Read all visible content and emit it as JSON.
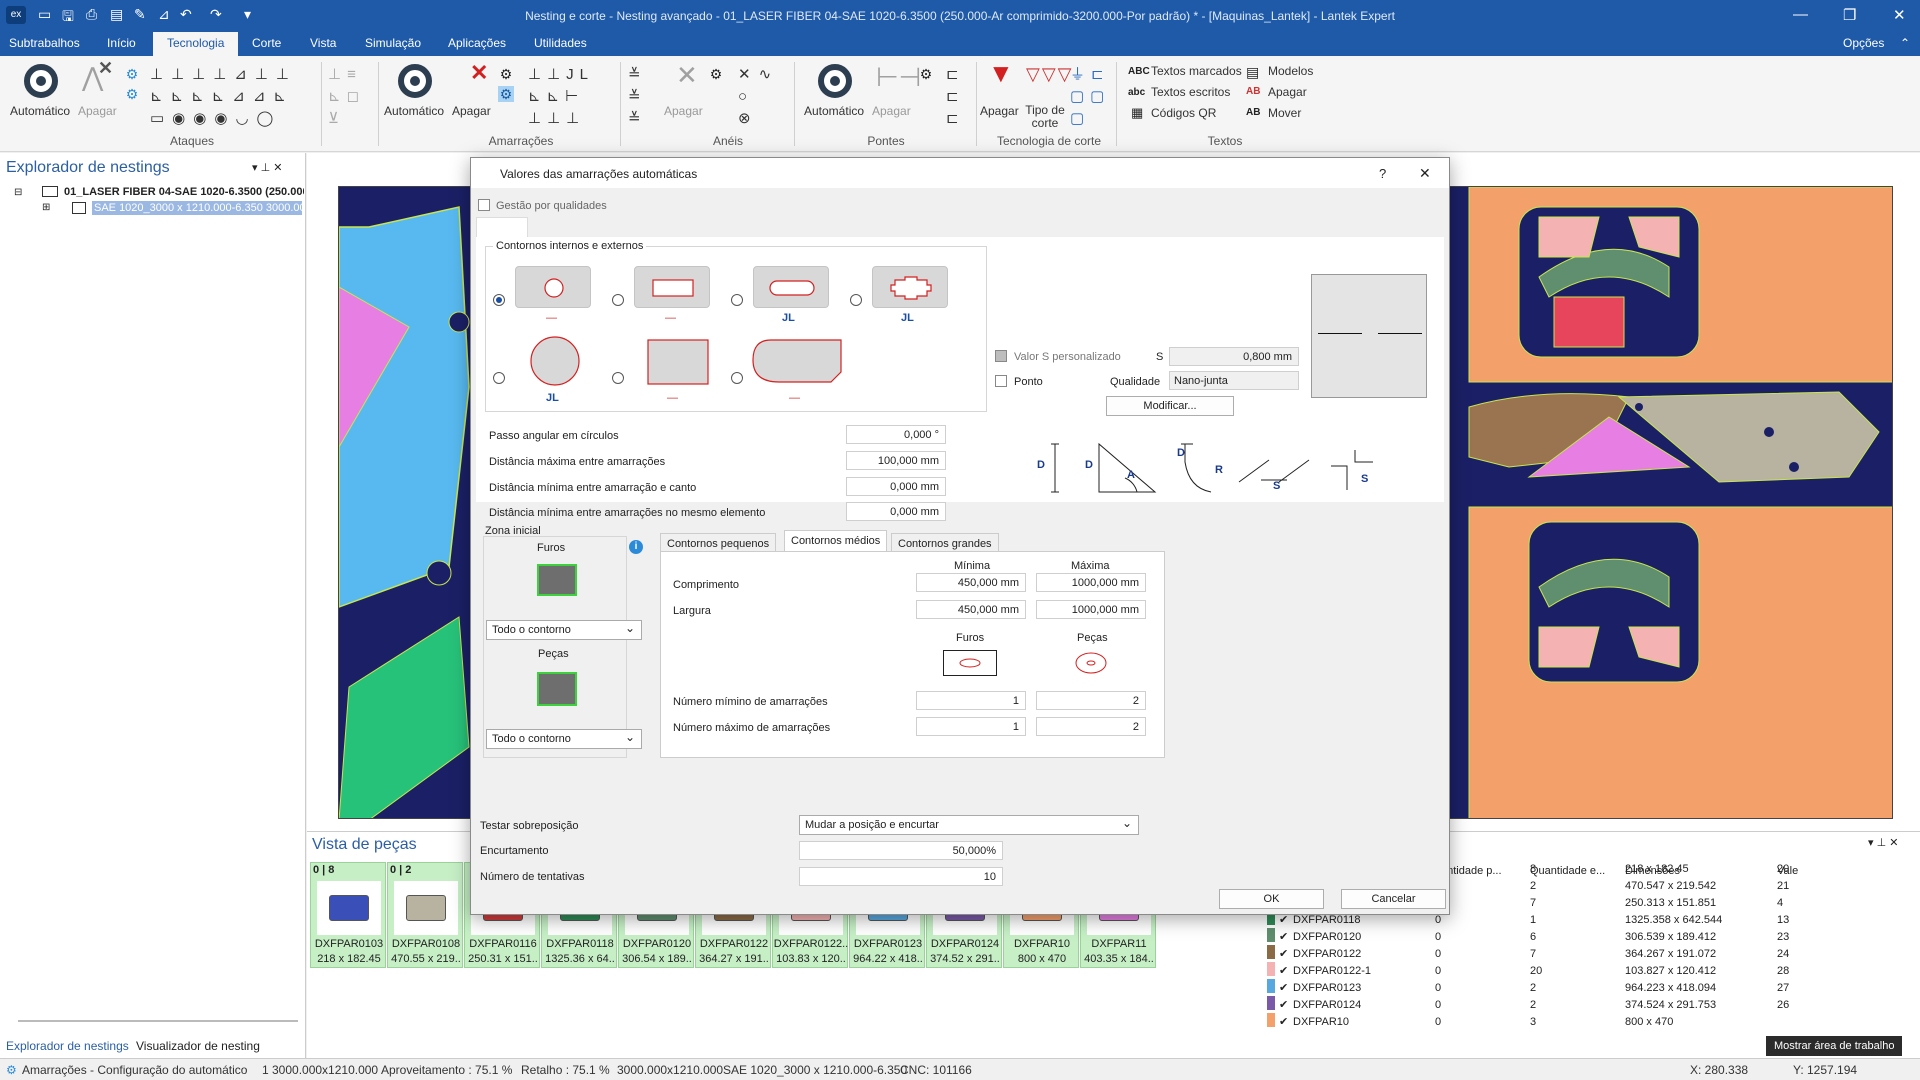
{
  "window": {
    "title": "Nesting e corte - Nesting avançado - 01_LASER FIBER 04-SAE 1020-6.3500 (250.000-Ar comprimido-3200.000-Por padrão) * - [Maquinas_Lantek] - Lantek Expert",
    "app_badge": "ex"
  },
  "menu": {
    "tabs": [
      "Subtrabalhos",
      "Início",
      "Tecnologia",
      "Corte",
      "Vista",
      "Simulação",
      "Aplicações",
      "Utilidades"
    ],
    "active": "Tecnologia",
    "options": "Opções"
  },
  "ribbon": {
    "automatico": "Automático",
    "apagar": "Apagar",
    "tipo_corte": "Tipo de corte",
    "groups": {
      "ataques": "Ataques",
      "amarracoes": "Amarrações",
      "aneis": "Anéis",
      "pontes": "Pontes",
      "tecnologia_corte": "Tecnologia de corte",
      "textos": "Textos"
    },
    "textos_items": {
      "marcados": "Textos marcados",
      "escritos": "Textos escritos",
      "qr": "Códigos QR",
      "modelos": "Modelos",
      "apagar": "Apagar",
      "mover": "Mover"
    },
    "abc_badge": "ABC",
    "abc_small": "abc",
    "ab_badge": "AB"
  },
  "explorer": {
    "title": "Explorador de nestings",
    "tree_root": "01_LASER FIBER 04-SAE 1020-6.3500 (250.000-",
    "tree_child": "SAE 1020_3000 x 1210.000-6.350 3000.000",
    "tabs": [
      "Explorador de nestings",
      "Visualizador de nesting"
    ]
  },
  "parts_view": {
    "title": "Vista de peças",
    "pieces": [
      {
        "count": "0 | 8",
        "name": "DXFPAR0103",
        "dims": "218 x 182.45"
      },
      {
        "count": "0 | 2",
        "name": "DXFPAR0108",
        "dims": "470.55 x 219.."
      },
      {
        "count": "",
        "name": "DXFPAR0116",
        "dims": "250.31 x 151.."
      },
      {
        "count": "",
        "name": "DXFPAR0118",
        "dims": "1325.36 x 64.."
      },
      {
        "count": "",
        "name": "DXFPAR0120",
        "dims": "306.54 x 189.."
      },
      {
        "count": "",
        "name": "DXFPAR0122",
        "dims": "364.27 x 191.."
      },
      {
        "count": "",
        "name": "DXFPAR0122..",
        "dims": "103.83 x 120.."
      },
      {
        "count": "",
        "name": "DXFPAR0123",
        "dims": "964.22 x 418.."
      },
      {
        "count": "",
        "name": "DXFPAR0124",
        "dims": "374.52 x 291.."
      },
      {
        "count": "",
        "name": "DXFPAR10",
        "dims": "800 x 470"
      },
      {
        "count": "",
        "name": "DXFPAR11",
        "dims": "403.35 x 184.."
      }
    ]
  },
  "parts_table": {
    "headers": [
      "antidade p...",
      "Quantidade e...",
      "Dimensões",
      "Vale"
    ],
    "rows": [
      {
        "name": "",
        "q1": "",
        "q2": "8",
        "dims": "218 x 182.45",
        "vale": "20",
        "color": "#3b4fb8"
      },
      {
        "name": "",
        "q1": "",
        "q2": "2",
        "dims": "470.547 x 219.542",
        "vale": "21",
        "color": "#a08060"
      },
      {
        "name": "DXFPAR0116",
        "q1": "0",
        "q2": "7",
        "dims": "250.313 x 151.851",
        "vale": "4",
        "color": "#d23b3b"
      },
      {
        "name": "DXFPAR0118",
        "q1": "0",
        "q2": "1",
        "dims": "1325.358 x 642.544",
        "vale": "13",
        "color": "#2e8b57"
      },
      {
        "name": "DXFPAR0120",
        "q1": "0",
        "q2": "6",
        "dims": "306.539 x 189.412",
        "vale": "23",
        "color": "#5f8f6f"
      },
      {
        "name": "DXFPAR0122",
        "q1": "0",
        "q2": "7",
        "dims": "364.267 x 191.072",
        "vale": "24",
        "color": "#8b6b45"
      },
      {
        "name": "DXFPAR0122-1",
        "q1": "0",
        "q2": "20",
        "dims": "103.827 x 120.412",
        "vale": "28",
        "color": "#f4b2b2"
      },
      {
        "name": "DXFPAR0123",
        "q1": "0",
        "q2": "2",
        "dims": "964.223 x 418.094",
        "vale": "27",
        "color": "#58a8e0"
      },
      {
        "name": "DXFPAR0124",
        "q1": "0",
        "q2": "2",
        "dims": "374.524 x 291.753",
        "vale": "26",
        "color": "#7a5aa8"
      },
      {
        "name": "DXFPAR10",
        "q1": "0",
        "q2": "3",
        "dims": "800 x 470",
        "vale": "",
        "color": "#f4a06a"
      }
    ]
  },
  "tooltip": "Mostrar área de trabalho",
  "status": {
    "left": "Amarrações - Configuração do automático",
    "sheet": "1  3000.000x1210.000",
    "aproveitamento": "Aproveitamento : 75.1 %",
    "retalho": "Retalho : 75.1 %",
    "dims": "3000.000x1210.000",
    "material": "SAE 1020_3000 x 1210.000-6.350",
    "cnc": "CNC: 101166",
    "x": "X: 280.338",
    "y": "Y: 1257.194"
  },
  "dialog": {
    "title": "Valores das amarrações automáticas",
    "help": "?",
    "close": "✕",
    "gestao": "Gestão por qualidades",
    "contornos_group": "Contornos internos e externos",
    "shape_marks": [
      "—",
      "—",
      "JL",
      "JL",
      "JL",
      "—",
      "—"
    ],
    "passo": {
      "label": "Passo angular em círculos",
      "value": "0,000 °"
    },
    "dist_max": {
      "label": "Distância máxima entre amarrações",
      "value": "100,000 mm"
    },
    "dist_canto": {
      "label": "Distância mínima entre amarração e canto",
      "value": "0,000 mm"
    },
    "dist_elem": {
      "label": "Distância mínima entre amarrações no mesmo elemento",
      "value": "0,000 mm"
    },
    "valor_s": "Valor S personalizado",
    "s_label": "S",
    "s_value": "0,800 mm",
    "ponto": "Ponto",
    "qualidade_label": "Qualidade",
    "qualidade_value": "Nano-junta",
    "modificar": "Modificar...",
    "diagram_letters": {
      "d": "D",
      "a": "A",
      "r": "R",
      "s": "S"
    },
    "zona_inicial": "Zona inicial",
    "furos": "Furos",
    "pecas": "Peças",
    "info": "i",
    "todo_contorno": "Todo o contorno",
    "tabs": [
      "Contornos pequenos",
      "Contornos médios",
      "Contornos grandes"
    ],
    "active_tab": "Contornos médios",
    "minima": "Mínima",
    "maxima": "Máxima",
    "comprimento": {
      "label": "Comprimento",
      "min": "450,000 mm",
      "max": "1000,000 mm"
    },
    "largura": {
      "label": "Largura",
      "min": "450,000 mm",
      "max": "1000,000 mm"
    },
    "num_min": {
      "label": "Número mímino de amarrações",
      "furos": "1",
      "pecas": "2"
    },
    "num_max": {
      "label": "Número máximo de amarrações",
      "furos": "1",
      "pecas": "2"
    },
    "testar": {
      "label": "Testar sobreposição",
      "value": "Mudar a posição e encurtar"
    },
    "encurtamento": {
      "label": "Encurtamento",
      "value": "50,000%"
    },
    "tentativas": {
      "label": "Número de tentativas",
      "value": "10"
    },
    "ok": "OK",
    "cancelar": "Cancelar"
  },
  "colors": {
    "accent": "#1e5aa8",
    "sheet": "#1b2066",
    "orange": "#f4a06a",
    "green_piece": "#c6efc6"
  }
}
